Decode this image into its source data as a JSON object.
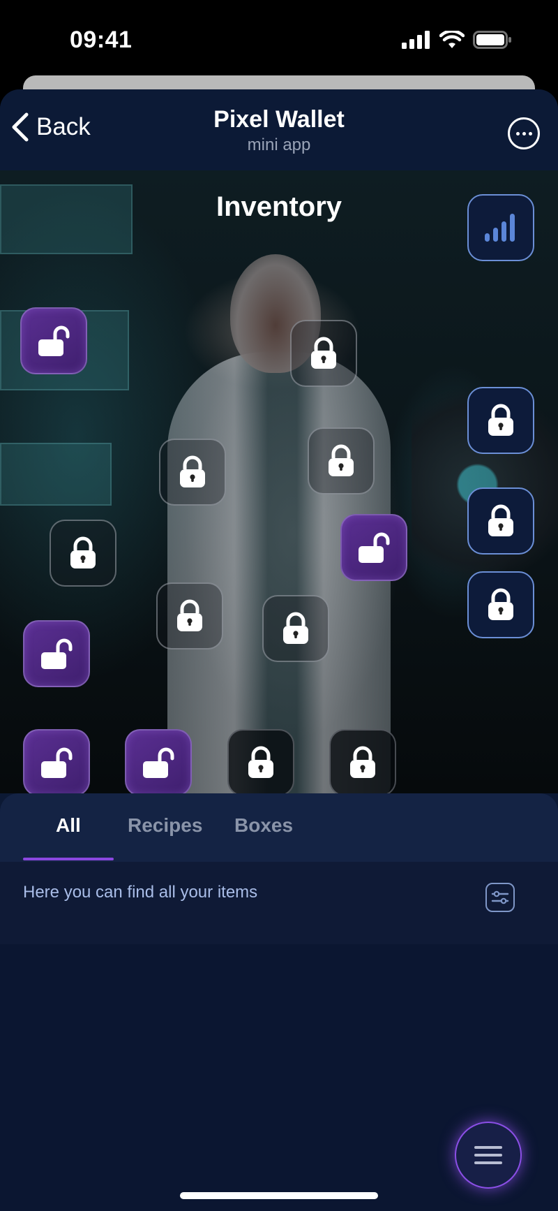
{
  "status_bar": {
    "time": "09:41"
  },
  "header": {
    "back_label": "Back",
    "title": "Pixel Wallet",
    "subtitle": "mini app"
  },
  "inventory": {
    "title": "Inventory",
    "slots": [
      {
        "id": "slot-1",
        "state": "unlocked"
      },
      {
        "id": "slot-2",
        "state": "locked"
      },
      {
        "id": "slot-3",
        "state": "locked"
      },
      {
        "id": "slot-4",
        "state": "locked"
      },
      {
        "id": "slot-5",
        "state": "locked"
      },
      {
        "id": "slot-6",
        "state": "unlocked"
      },
      {
        "id": "slot-7",
        "state": "locked"
      },
      {
        "id": "slot-8",
        "state": "locked"
      },
      {
        "id": "slot-9",
        "state": "unlocked"
      },
      {
        "id": "slot-10",
        "state": "unlocked"
      },
      {
        "id": "slot-11",
        "state": "unlocked"
      },
      {
        "id": "slot-12",
        "state": "locked"
      },
      {
        "id": "slot-13",
        "state": "locked"
      },
      {
        "id": "slot-14",
        "state": "locked"
      },
      {
        "id": "slot-15",
        "state": "locked"
      },
      {
        "id": "slot-16",
        "state": "locked"
      }
    ],
    "icons": {
      "stats": "bar-chart-icon",
      "next": "chevron-right-icon"
    }
  },
  "tabs": [
    {
      "label": "All",
      "active": true
    },
    {
      "label": "Recipes",
      "active": false
    },
    {
      "label": "Boxes",
      "active": false
    }
  ],
  "info": {
    "text": "Here you can find all your items",
    "filter_icon": "filter-icon"
  },
  "colors": {
    "accent": "#8b47e0",
    "background": "#0c1934",
    "unlocked": "#5a2f92",
    "tab_inactive": "#8a94a9",
    "info_text": "#a9bde8"
  }
}
